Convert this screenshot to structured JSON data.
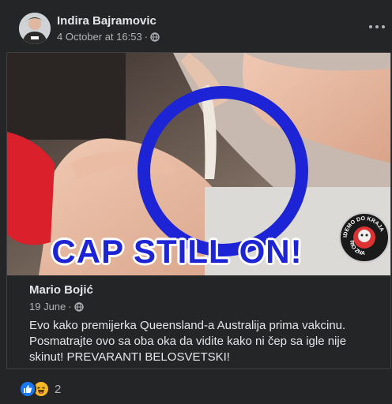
{
  "post": {
    "author": "Indira Bajramovic",
    "time": "4 October at 16:53",
    "separator": "·",
    "privacy_icon": "globe-icon",
    "more_icon": "more-horizontal-icon"
  },
  "shared": {
    "image_caption": "CAP STILL ON!",
    "seal_text_top": "IDEMO DO KRAJA",
    "seal_text_bottom": "RIO ZNA",
    "author": "Mario Bojić",
    "time": "19 June",
    "separator": "·",
    "privacy_icon": "globe-icon",
    "text_lines": [
      "Evo kako premijerka Queensland-a Australija prima vakcinu.",
      "Posmatrajte ovo sa oba oka da vidite kako ni čep sa igle nije",
      "skinut! PREVARANTI BELOSVETSKI!"
    ]
  },
  "reactions": {
    "icons": [
      "like-icon",
      "haha-icon"
    ],
    "count": "2"
  },
  "colors": {
    "background": "#242526",
    "text_primary": "#e4e6eb",
    "text_secondary": "#b0b3b8",
    "like_blue": "#1877f2",
    "haha_yellow": "#f7b928",
    "circle_blue": "#1d24d6"
  }
}
